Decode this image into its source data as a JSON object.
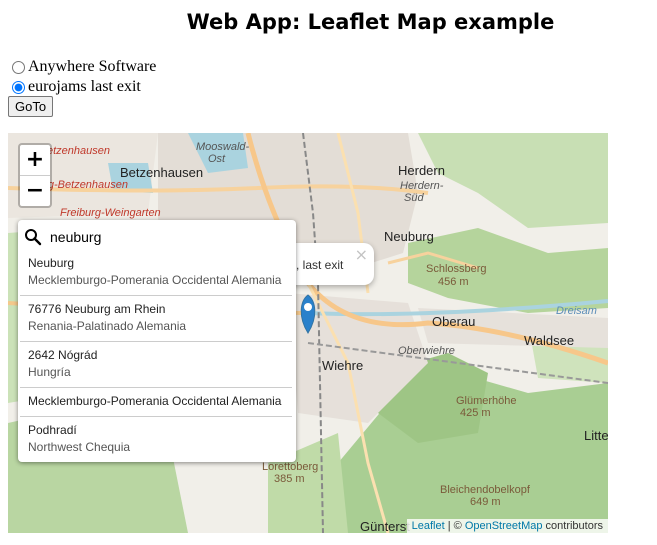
{
  "page": {
    "title": "Web App: Leaflet Map example"
  },
  "locations": {
    "options": [
      {
        "label": "Anywhere Software",
        "checked": false
      },
      {
        "label": "eurojams last exit",
        "checked": true
      }
    ],
    "goto_label": "GoTo"
  },
  "map": {
    "zoom_in": "+",
    "zoom_out": "−",
    "search": {
      "value": "neuburg",
      "results": [
        {
          "name": "Neuburg",
          "region": "Mecklemburgo-Pomerania Occidental Alemania"
        },
        {
          "name": "76776 Neuburg am Rhein",
          "region": "Renania-Palatinado Alemania"
        },
        {
          "name": "2642 Nógrád",
          "region": "Hungría"
        },
        {
          "name": "Mecklemburgo-Pomerania Occidental Alemania",
          "region": ""
        },
        {
          "name": "Podhradí",
          "region": "Northwest Chequia"
        }
      ]
    },
    "popup": {
      "text": "m, last exit",
      "close": "×"
    },
    "places": {
      "betzenhausen_red": "-Betzenhausen",
      "betzenhausen": "Betzenhausen",
      "mooswald": "Mooswald-",
      "ost": "Ost",
      "burg_betzenhausen": "burg-Betzenhausen",
      "freiburg_weingarten": "Freiburg-Weingarten",
      "herdern": "Herdern",
      "herdern_sud_1": "Herdern-",
      "herdern_sud_2": "Süd",
      "neuburg": "Neuburg",
      "schlossberg": "Schlossberg",
      "schlossberg_alt": "456 m",
      "oberau": "Oberau",
      "dreisam": "Dreisam",
      "waldsee": "Waldsee",
      "oberwiehre": "Oberwiehre",
      "wiehre": "Wiehre",
      "glumerhohe": "Glümerhöhe",
      "glumerhohe_alt": "425 m",
      "lorettoberg": "Lorettoberg",
      "lorettoberg_alt": "385 m",
      "bleichendobelkopf": "Bleichendobelkopf",
      "bleichendobelkopf_alt": "649 m",
      "gunterstal": "Günterst",
      "litte": "Litte"
    },
    "attribution": {
      "leaflet": "Leaflet",
      "sep": " | © ",
      "osm": "OpenStreetMap",
      "suffix": " contributors"
    }
  }
}
